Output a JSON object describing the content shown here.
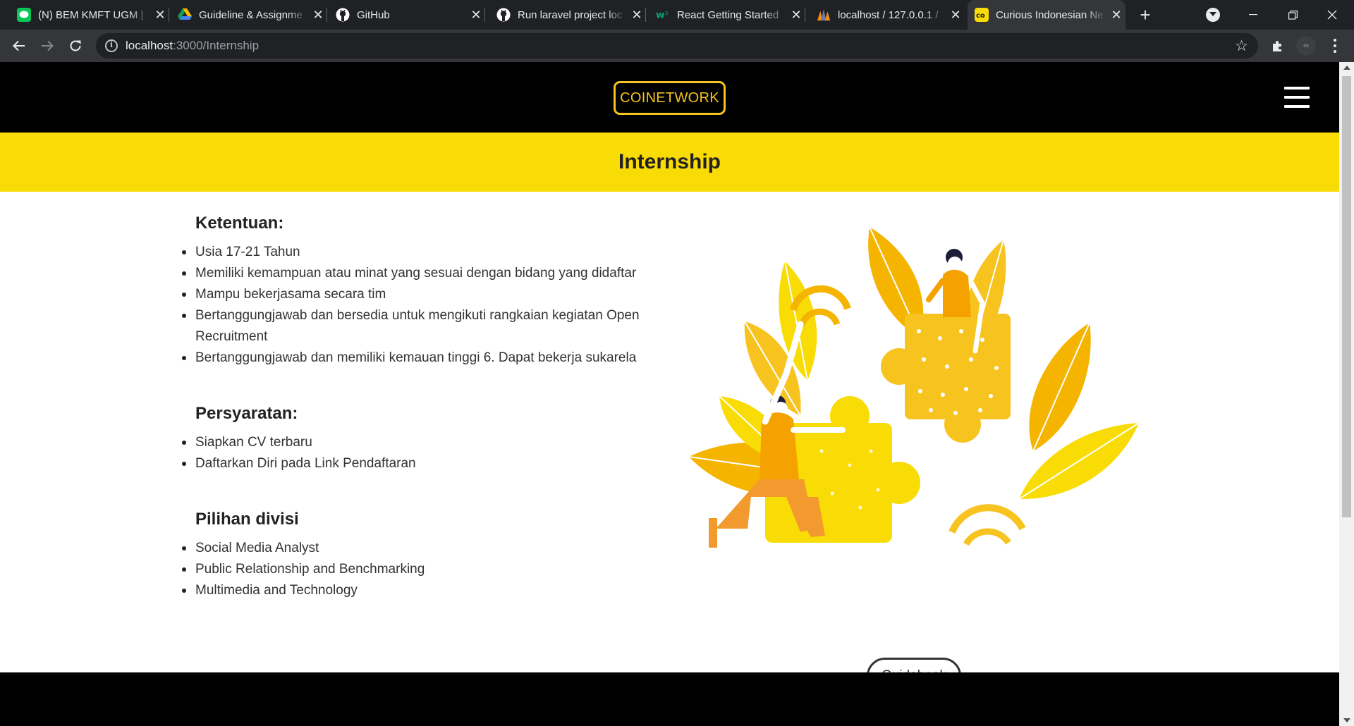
{
  "browser": {
    "tabs": [
      {
        "title": "(N) BEM KMFT UGM | ",
        "favicon": "line-messenger-icon",
        "active": false
      },
      {
        "title": "Guideline & Assignme",
        "favicon": "google-drive-icon",
        "active": false
      },
      {
        "title": "GitHub",
        "favicon": "github-icon",
        "active": false
      },
      {
        "title": "Run laravel project loc",
        "favicon": "github-icon",
        "active": false
      },
      {
        "title": "React Getting Started",
        "favicon": "w3schools-icon",
        "active": false
      },
      {
        "title": "localhost / 127.0.0.1 / ",
        "favicon": "phpmyadmin-icon",
        "active": false
      },
      {
        "title": "Curious Indonesian Ne",
        "favicon": "coinetwork-favicon",
        "active": true
      }
    ],
    "address": {
      "host": "localhost",
      "path": ":3000/Internship"
    },
    "profile_label": "∞"
  },
  "site": {
    "logo": "COINETWORK",
    "page_title": "Internship",
    "sections": [
      {
        "title": "Ketentuan:",
        "items": [
          "Usia 17-21 Tahun",
          "Memiliki kemampuan atau minat yang sesuai dengan bidang yang didaftar",
          "Mampu bekerjasama secara tim",
          "Bertanggungjawab dan bersedia untuk mengikuti rangkaian kegiatan Open Recruitment",
          "Bertanggungjawab dan memiliki kemauan tinggi 6. Dapat bekerja sukarela"
        ]
      },
      {
        "title": "Persyaratan:",
        "items": [
          "Siapkan CV terbaru",
          "Daftarkan Diri pada Link Pendaftaran"
        ]
      },
      {
        "title": "Pilihan divisi",
        "items": [
          "Social Media Analyst",
          "Public Relationship and Benchmarking",
          "Multimedia and Technology"
        ]
      }
    ],
    "guidebook_label": "Guidebook",
    "colors": {
      "accent_yellow": "#f9dc05",
      "logo_gold": "#f7c31e",
      "nav_black": "#000000"
    }
  }
}
